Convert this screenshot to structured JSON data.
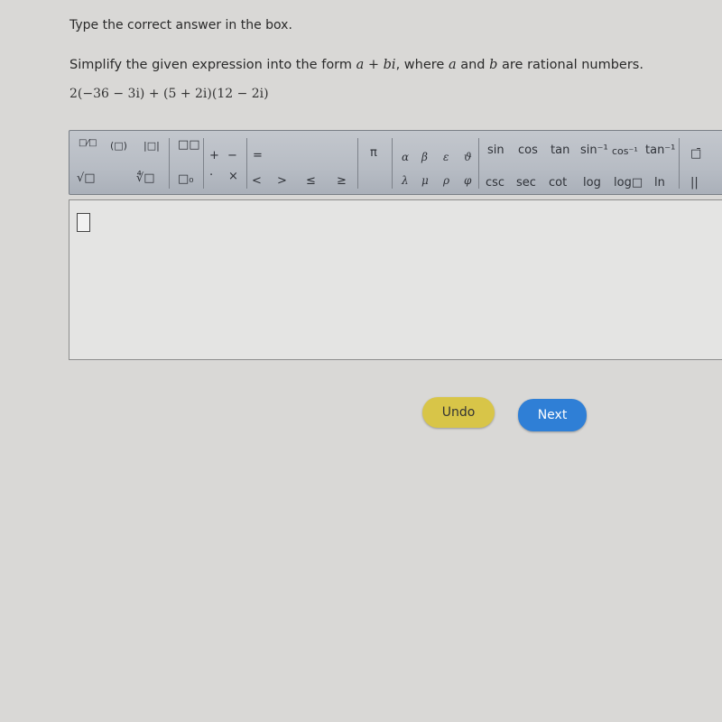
{
  "instruction": "Type the correct answer in the box.",
  "question": {
    "prefix": "Simplify the given expression into the form ",
    "form": "a + bi",
    "middle": ", where ",
    "a": "a",
    "and": " and ",
    "b": "b",
    "suffix": " are rational numbers."
  },
  "expression": "2(−36 − 3i) + (5 + 2i)(12 − 2i)",
  "toolbar": {
    "fraction": "□⁄□",
    "parentheses": "(□)",
    "absolute": "|□|",
    "superscript": "□□",
    "sqrt": "√□",
    "nthroot": "∜□",
    "subscript": "□₀",
    "plus": "+",
    "minus": "−",
    "dot": "·",
    "times": "×",
    "equals": "=",
    "lt": "<",
    "gt": ">",
    "le": "≤",
    "ge": "≥",
    "pi": "π",
    "alpha": "α",
    "beta": "β",
    "epsilon": "ε",
    "theta": "ϑ",
    "lambda": "λ",
    "mu": "μ",
    "rho": "ρ",
    "phi": "φ",
    "sin": "sin",
    "cos": "cos",
    "tan": "tan",
    "asin": "sin⁻¹",
    "acos": "cos⁻¹",
    "atan": "tan⁻¹",
    "csc": "csc",
    "sec": "sec",
    "cot": "cot",
    "log": "log",
    "logn": "log□",
    "ln": "ln",
    "overline": "□̄",
    "parallel": "||"
  },
  "buttons": {
    "undo": "Undo",
    "next": "Next"
  },
  "colors": {
    "undo": "#d8c548",
    "next": "#2f7fd6"
  }
}
